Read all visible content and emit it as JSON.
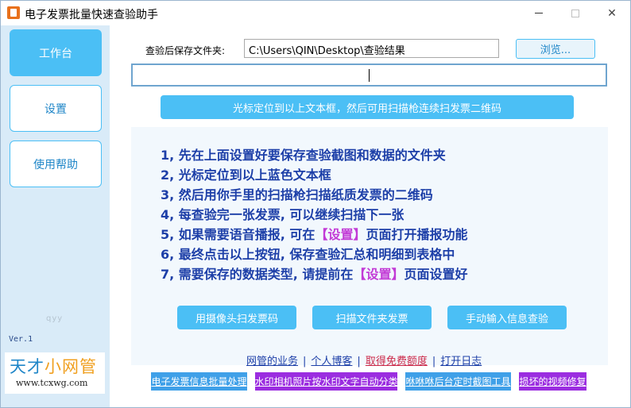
{
  "window": {
    "title": "电子发票批量快速查验助手",
    "controls": {
      "minimize": "—",
      "maximize": "☐",
      "close": "✕"
    }
  },
  "sidebar": {
    "items": [
      {
        "label": "工作台",
        "active": true
      },
      {
        "label": "设置",
        "active": false
      },
      {
        "label": "使用帮助",
        "active": false
      }
    ],
    "watermark": "qyy",
    "version": "Ver.1",
    "logo": {
      "text_main": "天才",
      "text_accent": "小网管",
      "url": "www.tcxwg.com"
    }
  },
  "main": {
    "save_label": "查验后保存文件夹:",
    "save_path": "C:\\Users\\QIN\\Desktop\\查验结果",
    "browse_label": "浏览...",
    "scan_value": "",
    "scan_hint": "光标定位到以上文本框，然后可用扫描枪连续扫发票二维码",
    "instructions": [
      {
        "text": "1, 先在上面设置好要保存查验截图和数据的文件夹"
      },
      {
        "text": "2, 光标定位到以上蓝色文本框"
      },
      {
        "text": "3, 然后用你手里的扫描枪扫描纸质发票的二维码"
      },
      {
        "text": "4, 每查验完一张发票, 可以继续扫描下一张"
      },
      {
        "pre": "5, 如果需要语音播报, 可在",
        "mid": "【设置】",
        "post": "页面打开播报功能"
      },
      {
        "text": "6, 最终点击以上按钮, 保存查验汇总和明细到表格中"
      },
      {
        "pre": "7, 需要保存的数据类型, 请提前在",
        "mid": "【设置】",
        "post": "页面设置好"
      }
    ],
    "action_buttons": [
      {
        "label": "用摄像头扫发票码"
      },
      {
        "label": "扫描文件夹发票"
      },
      {
        "label": "手动输入信息查验"
      }
    ],
    "links": [
      {
        "label": "网管的业务"
      },
      {
        "label": "个人博客"
      },
      {
        "label": "取得免费额度"
      },
      {
        "label": "打开日志"
      }
    ],
    "link_separator": "|",
    "promos": [
      {
        "label": "电子发票信息批量处理"
      },
      {
        "label": "水印相机照片按水印文字自动分类"
      },
      {
        "label": "咻咻咻后台定时截图工具"
      },
      {
        "label": "损坏的视频修复"
      }
    ]
  },
  "colors": {
    "accent_blue": "#4bbff5",
    "instruction_text": "#1d3fa8",
    "highlight_magenta": "#c23bd6",
    "link_red": "#cc2a4a",
    "promo_purple": "#9b2de0",
    "sidebar_bg": "#d9ebf8"
  }
}
